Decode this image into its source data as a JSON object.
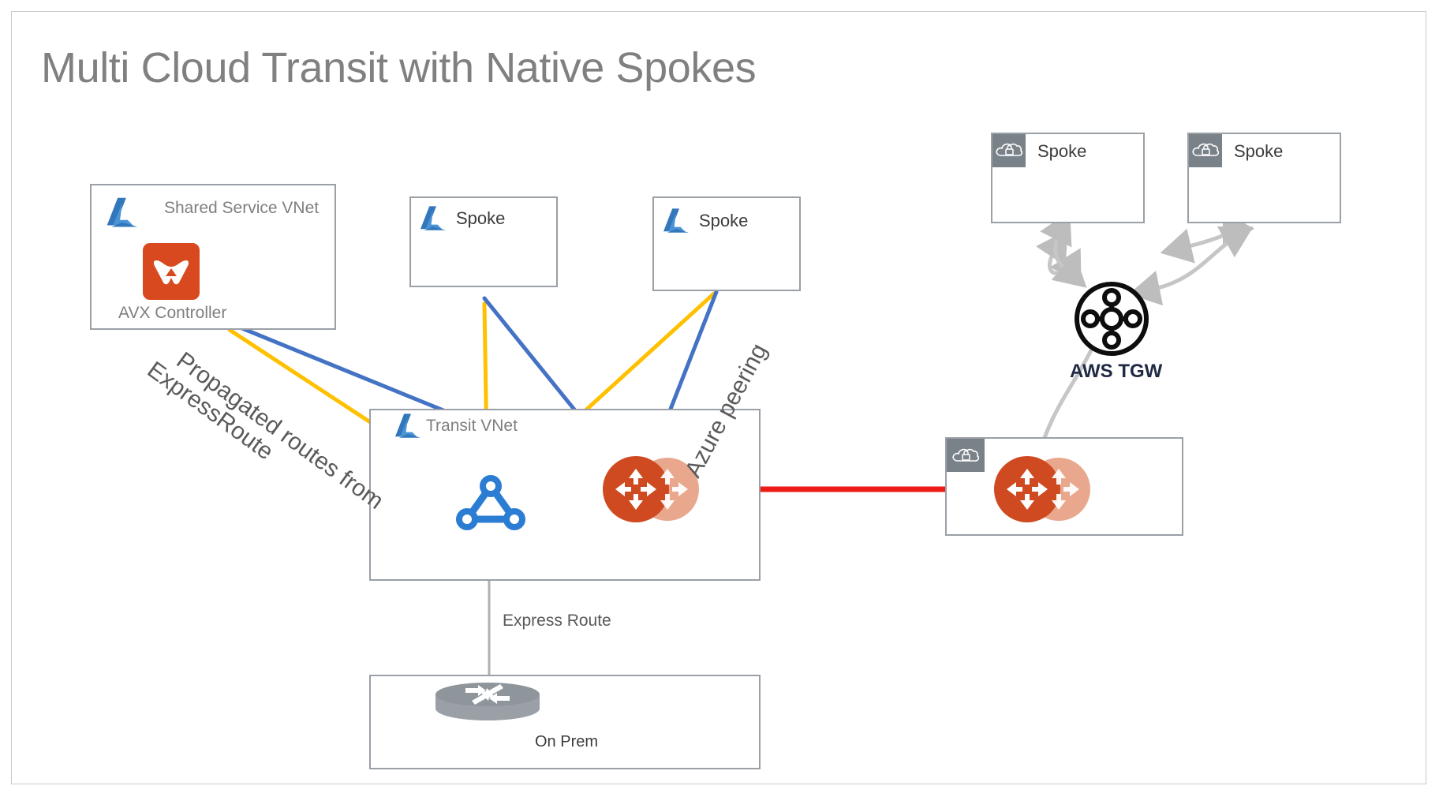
{
  "page": {
    "title": "Multi Cloud Transit with Native Spokes",
    "background_color": "#ffffff",
    "frame_color": "#c9c9c9"
  },
  "colors": {
    "azure_blue": "#3277bc",
    "aviatrix_orange": "#d9491f",
    "aviatrix_orange_light": "#e9a78d",
    "line_blue": "#4472c4",
    "line_yellow": "#ffc000",
    "line_red": "#ed1c16",
    "line_gray": "#b0b0b0",
    "box_border": "#9aa0a6",
    "title_gray": "#808080",
    "vpc_tab_gray": "#7a8289",
    "tgw_black": "#0d0d0d",
    "tgw_label_navy": "#1f2a44"
  },
  "azure": {
    "shared_service_vnet": {
      "label": "Shared Service VNet",
      "logo_icon": "azure-logo-icon",
      "controller": {
        "label": "AVX Controller",
        "icon": "aviatrix-controller-icon"
      }
    },
    "spokes": [
      {
        "label": "Spoke",
        "logo_icon": "azure-logo-icon"
      },
      {
        "label": "Spoke",
        "logo_icon": "azure-logo-icon"
      }
    ],
    "transit_vnet": {
      "label": "Transit VNet",
      "logo_icon": "azure-logo-icon",
      "vnet_gateway_icon": "azure-vnet-gateway-icon",
      "aviatrix_gateway_icon": "aviatrix-gateway-icon"
    },
    "on_prem": {
      "label": "On Prem",
      "icon": "router-icon"
    }
  },
  "aws": {
    "spokes": [
      {
        "label": "Spoke",
        "icon": "aws-vpc-icon"
      },
      {
        "label": "Spoke",
        "icon": "aws-vpc-icon"
      }
    ],
    "tgw": {
      "label": "AWS TGW",
      "icon": "aws-transit-gateway-icon"
    },
    "transit_vpc": {
      "icon": "aws-vpc-icon",
      "aviatrix_gateway_icon": "aviatrix-gateway-icon"
    }
  },
  "connections": {
    "propagated_routes": {
      "line1": "Propagated routes from",
      "line2": "ExpressRoute"
    },
    "azure_peering": "Azure peering",
    "express_route": "Express Route"
  }
}
